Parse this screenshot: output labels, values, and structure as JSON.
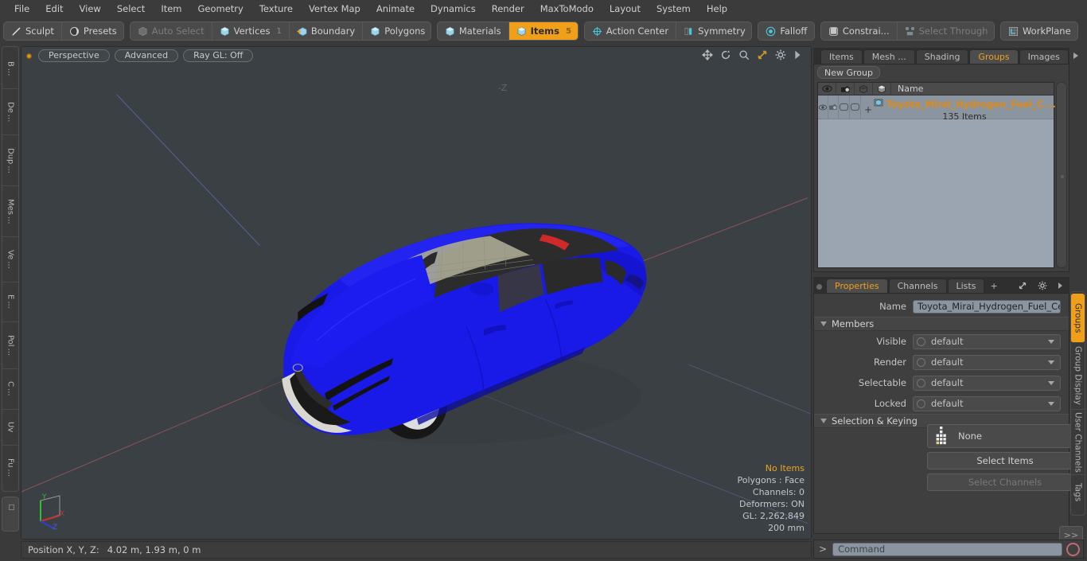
{
  "app": {
    "name": "Modo",
    "accent": "#f0a018",
    "panel_bg": "#3f3f3f",
    "viewport_bg": "#3b4044"
  },
  "menubar": {
    "items": [
      {
        "label": "File"
      },
      {
        "label": "Edit"
      },
      {
        "label": "View"
      },
      {
        "label": "Select"
      },
      {
        "label": "Item"
      },
      {
        "label": "Geometry"
      },
      {
        "label": "Texture"
      },
      {
        "label": "Vertex Map"
      },
      {
        "label": "Animate"
      },
      {
        "label": "Dynamics"
      },
      {
        "label": "Render"
      },
      {
        "label": "MaxToModo"
      },
      {
        "label": "Layout"
      },
      {
        "label": "System"
      },
      {
        "label": "Help"
      }
    ]
  },
  "toolbar": {
    "groups": [
      {
        "buttons": [
          {
            "label": "Sculpt",
            "icon": "pencil-icon",
            "state": "normal",
            "count": ""
          },
          {
            "label": "Presets",
            "icon": "sphere-icon",
            "state": "normal",
            "count": ""
          }
        ]
      },
      {
        "buttons": [
          {
            "label": "Auto Select",
            "icon": "cube-grey-icon",
            "state": "disabled",
            "count": ""
          },
          {
            "label": "Vertices",
            "icon": "cube-blue-icon",
            "state": "normal",
            "count": "1"
          },
          {
            "label": "Boundary",
            "icon": "cube-arrow-icon",
            "state": "normal",
            "count": ""
          },
          {
            "label": "Polygons",
            "icon": "cube-blue-icon",
            "state": "normal",
            "count": ""
          }
        ]
      },
      {
        "buttons": [
          {
            "label": "Materials",
            "icon": "cube-blue-icon",
            "state": "normal",
            "count": ""
          },
          {
            "label": "Items",
            "icon": "cube-blue-icon",
            "state": "active",
            "count": "5"
          }
        ]
      },
      {
        "buttons": [
          {
            "label": "Action Center",
            "icon": "target-icon",
            "state": "normal",
            "count": ""
          },
          {
            "label": "Symmetry",
            "icon": "mirror-icon",
            "state": "normal",
            "count": ""
          }
        ]
      },
      {
        "buttons": [
          {
            "label": "Falloff",
            "icon": "falloff-icon",
            "state": "normal",
            "count": ""
          }
        ]
      },
      {
        "buttons": [
          {
            "label": "Constrai...",
            "icon": "constraint-icon",
            "state": "normal",
            "count": ""
          },
          {
            "label": "Select Through",
            "icon": "select-through-icon",
            "state": "disabled",
            "count": ""
          }
        ]
      },
      {
        "buttons": [
          {
            "label": "WorkPlane",
            "icon": "workplane-icon",
            "state": "normal",
            "count": ""
          }
        ]
      }
    ]
  },
  "left_tabs": {
    "items": [
      {
        "label": "B ..."
      },
      {
        "label": "De ..."
      },
      {
        "label": "Dup ..."
      },
      {
        "label": "Mes ..."
      },
      {
        "label": "Ve ..."
      },
      {
        "label": "E ..."
      },
      {
        "label": "Pol ..."
      },
      {
        "label": "C ..."
      },
      {
        "label": "Uv"
      },
      {
        "label": "Fu ..."
      }
    ]
  },
  "viewport": {
    "view_mode": "Perspective",
    "shading_mode": "Advanced",
    "ray_gl": "Ray GL: Off",
    "axis_hint": "-Z",
    "icons": [
      "move-icon",
      "rotate-icon",
      "zoom-icon",
      "fit-icon",
      "gear-icon",
      "play-arrow-icon"
    ],
    "stats": [
      {
        "label": "No Items",
        "highlight": true
      },
      {
        "label": "Polygons : Face",
        "highlight": false
      },
      {
        "label": "Channels: 0",
        "highlight": false
      },
      {
        "label": "Deformers: ON",
        "highlight": false
      },
      {
        "label": "GL: 2,262,849",
        "highlight": false
      },
      {
        "label": "200 mm",
        "highlight": false
      }
    ],
    "gizmo": {
      "x": "X",
      "y": "Y",
      "z": "Z"
    },
    "model": {
      "name": "Toyota Mirai",
      "body_color": "#1616e8",
      "glass_color": "#2b2b2b",
      "wheel_color": "#d8d8d8"
    }
  },
  "groups_panel": {
    "tabs": [
      {
        "label": "Items",
        "selected": false
      },
      {
        "label": "Mesh ...",
        "selected": false
      },
      {
        "label": "Shading",
        "selected": false
      },
      {
        "label": "Groups",
        "selected": true
      },
      {
        "label": "Images",
        "selected": false
      }
    ],
    "plus_label": "+",
    "new_group_label": "New Group",
    "columns": [
      {
        "icon": "eye-icon"
      },
      {
        "icon": "camera-icon"
      },
      {
        "icon": "cube-outline-icon"
      },
      {
        "icon": "cube-shaded-icon"
      }
    ],
    "name_column": "Name",
    "rows": [
      {
        "name": "Toyota_Mirai_Hydrogen_Fuel_C ...",
        "subtitle": "135 Items",
        "expand": "+",
        "icon": "group-icon"
      }
    ]
  },
  "properties_panel": {
    "tabs": [
      {
        "label": "Properties",
        "selected": true
      },
      {
        "label": "Channels",
        "selected": false
      },
      {
        "label": "Lists",
        "selected": false
      }
    ],
    "plus_label": "+",
    "name_label": "Name",
    "name_value": "Toyota_Mirai_Hydrogen_Fuel_Cell_Vel",
    "members_section": "Members",
    "member_rows": [
      {
        "label": "Visible",
        "value": "default"
      },
      {
        "label": "Render",
        "value": "default"
      },
      {
        "label": "Selectable",
        "value": "default"
      },
      {
        "label": "Locked",
        "value": "default"
      }
    ],
    "selection_section": "Selection & Keying",
    "keying_dropdown": "None",
    "select_items_label": "Select Items",
    "select_channels_label": "Select Channels",
    "more_label": ">>"
  },
  "right_tabs": {
    "items": [
      {
        "label": "Groups",
        "selected": true
      },
      {
        "label": "Group Display",
        "selected": false
      },
      {
        "label": "User Channels",
        "selected": false
      },
      {
        "label": "Tags",
        "selected": false
      }
    ]
  },
  "statusbar": {
    "position_label": "Position X, Y, Z:",
    "position_value": "4.02 m, 1.93 m, 0 m"
  },
  "command_bar": {
    "prompt": ">",
    "placeholder": "Command",
    "record_icon": "record-icon"
  }
}
